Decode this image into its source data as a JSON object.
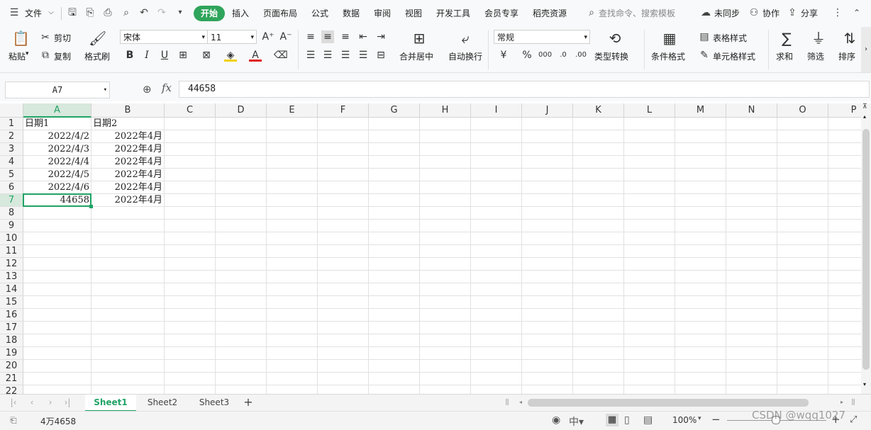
{
  "menu": {
    "file": "文件",
    "active_tab": "开始",
    "tabs": [
      "插入",
      "页面布局",
      "公式",
      "数据",
      "审阅",
      "视图",
      "开发工具",
      "会员专享",
      "稻壳资源"
    ],
    "search_placeholder": "查找命令、搜索模板",
    "sync": "未同步",
    "collab": "协作",
    "share": "分享"
  },
  "ribbon": {
    "paste": "粘贴",
    "cut": "剪切",
    "copy": "复制",
    "format_painter": "格式刷",
    "font_name": "宋体",
    "font_size": "11",
    "merge_center": "合并居中",
    "wrap_text": "自动换行",
    "number_format": "常规",
    "type_convert": "类型转换",
    "cond_format": "条件格式",
    "table_style": "表格样式",
    "cell_style": "单元格样式",
    "sum": "求和",
    "filter": "筛选",
    "sort": "排序"
  },
  "formula_bar": {
    "cell_ref": "A7",
    "fx": "fx",
    "value": "44658"
  },
  "columns": [
    "A",
    "B",
    "C",
    "D",
    "E",
    "F",
    "G",
    "H",
    "I",
    "J",
    "K",
    "L",
    "M",
    "N",
    "O",
    "P"
  ],
  "rows": [
    "1",
    "2",
    "3",
    "4",
    "5",
    "6",
    "7",
    "8",
    "9",
    "10",
    "11",
    "12",
    "13",
    "14",
    "15",
    "16",
    "17",
    "18",
    "19",
    "20",
    "21",
    "22"
  ],
  "cells": {
    "A1": "日期1",
    "B1": "日期2",
    "A2": "2022/4/2",
    "B2": "2022年4月",
    "A3": "2022/4/3",
    "B3": "2022年4月",
    "A4": "2022/4/4",
    "B4": "2022年4月",
    "A5": "2022/4/5",
    "B5": "2022年4月",
    "A6": "2022/4/6",
    "B6": "2022年4月",
    "A7": "44658",
    "B7": "2022年4月"
  },
  "sheets": [
    "Sheet1",
    "Sheet2",
    "Sheet3"
  ],
  "active_sheet": "Sheet1",
  "status": {
    "count": "4万4658",
    "zoom": "100%",
    "watermark": "CSDN @wqq1027"
  },
  "colors": {
    "accent": "#2fa45b",
    "selection": "#21a366"
  }
}
